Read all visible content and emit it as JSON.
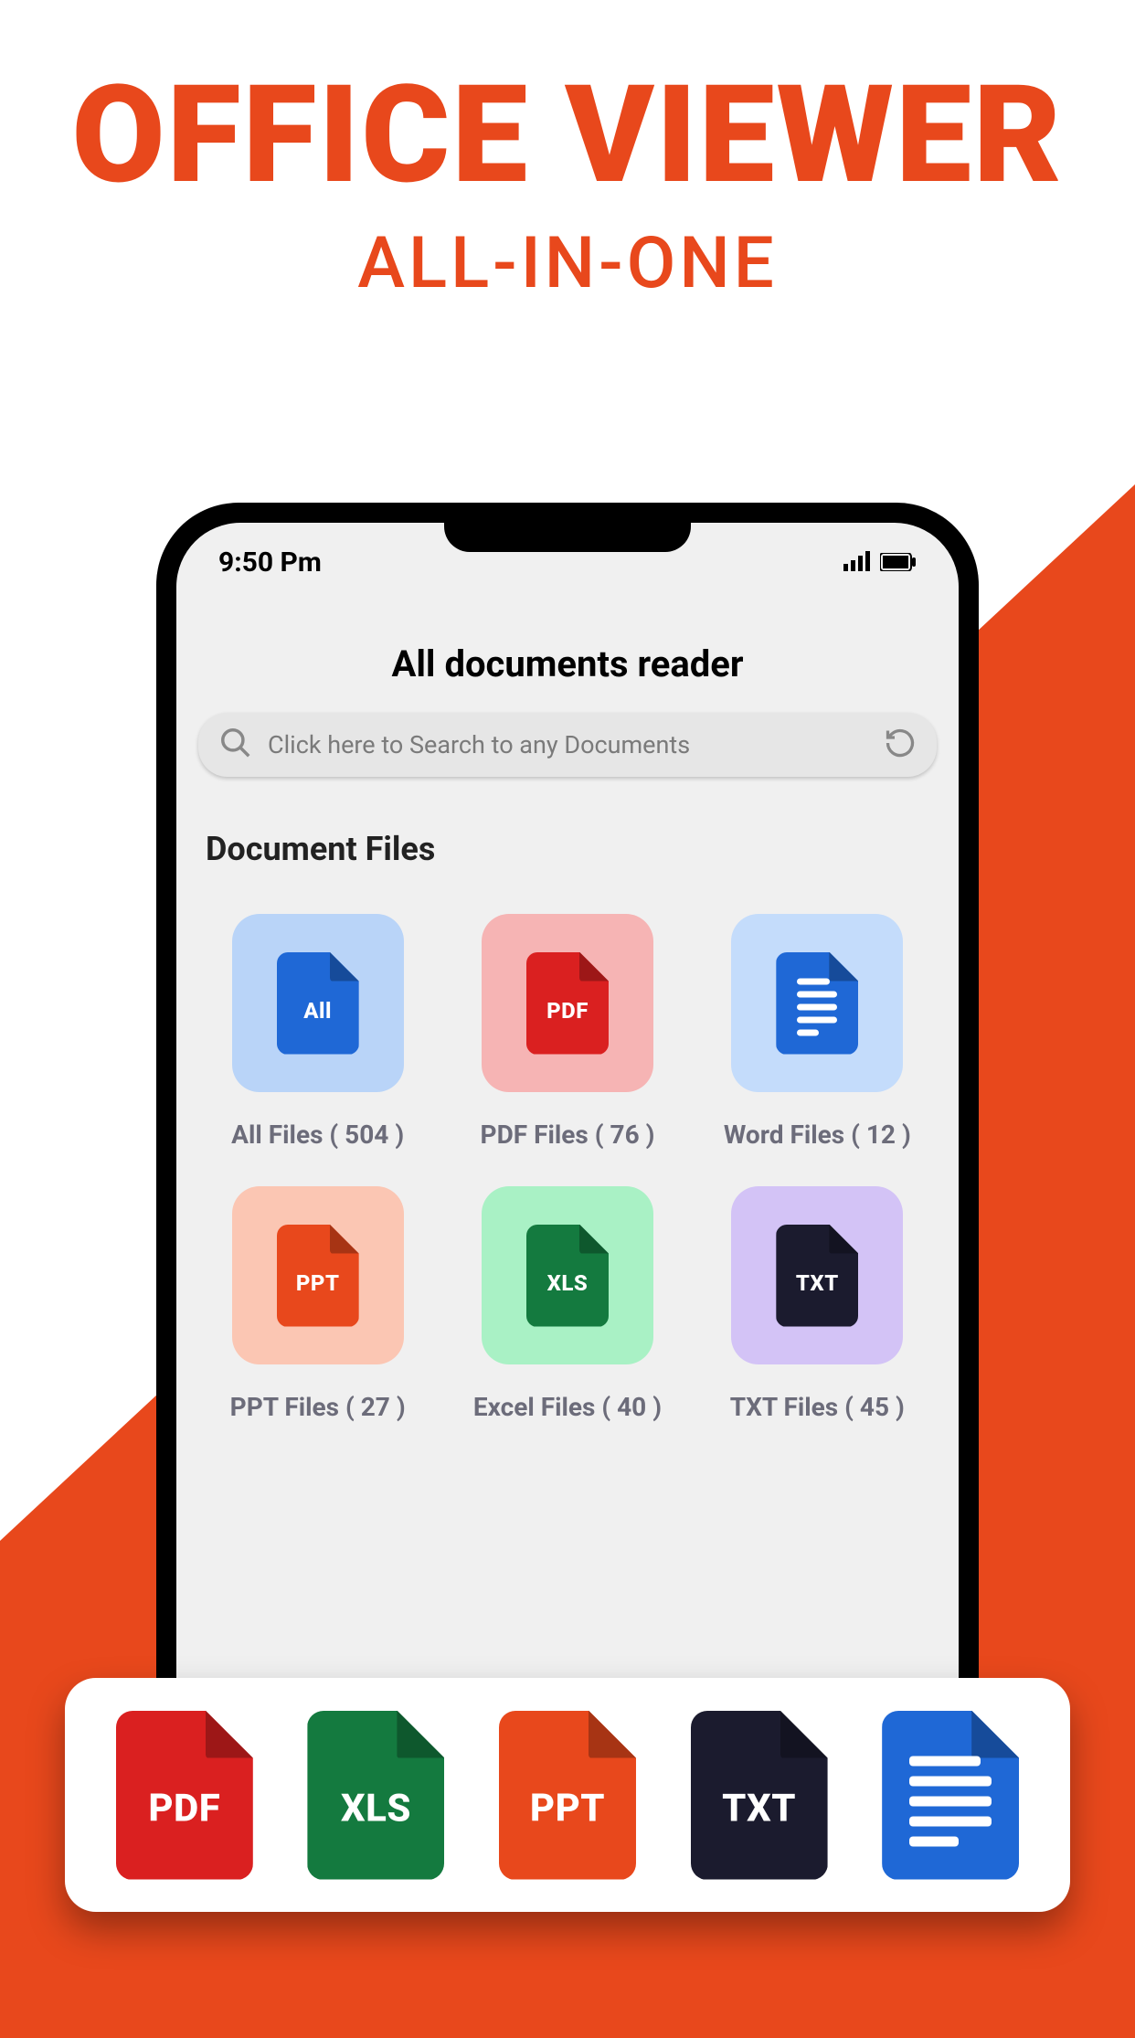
{
  "hero": {
    "title": "OFFICE VIEWER",
    "subtitle": "ALL-IN-ONE"
  },
  "status": {
    "time": "9:50 Pm"
  },
  "app": {
    "title": "All documents reader",
    "searchPlaceholder": "Click here to Search to any Documents",
    "sectionTitle": "Document Files"
  },
  "tiles": [
    {
      "label": "All Files ( 504 )",
      "iconText": "All",
      "bg": "#b9d4f8",
      "fileColor": "#1f68d6"
    },
    {
      "label": "PDF Files ( 76 )",
      "iconText": "PDF",
      "bg": "#f6b4b4",
      "fileColor": "#da2020"
    },
    {
      "label": "Word Files ( 12 )",
      "iconText": "DOC",
      "bg": "#c4dcfb",
      "fileColor": "#1f68d6"
    },
    {
      "label": "PPT Files ( 27 )",
      "iconText": "PPT",
      "bg": "#fbc6b3",
      "fileColor": "#e8481c"
    },
    {
      "label": "Excel Files ( 40 )",
      "iconText": "XLS",
      "bg": "#a9f1c5",
      "fileColor": "#147a3f"
    },
    {
      "label": "TXT Files ( 45 )",
      "iconText": "TXT",
      "bg": "#d3c3f6",
      "fileColor": "#1b1b2e"
    }
  ],
  "bottomIcons": [
    {
      "text": "PDF",
      "color": "#da2020"
    },
    {
      "text": "XLS",
      "color": "#147a3f"
    },
    {
      "text": "PPT",
      "color": "#e8481c"
    },
    {
      "text": "TXT",
      "color": "#1b1b2e"
    },
    {
      "text": "DOC",
      "color": "#1f68d6"
    }
  ]
}
